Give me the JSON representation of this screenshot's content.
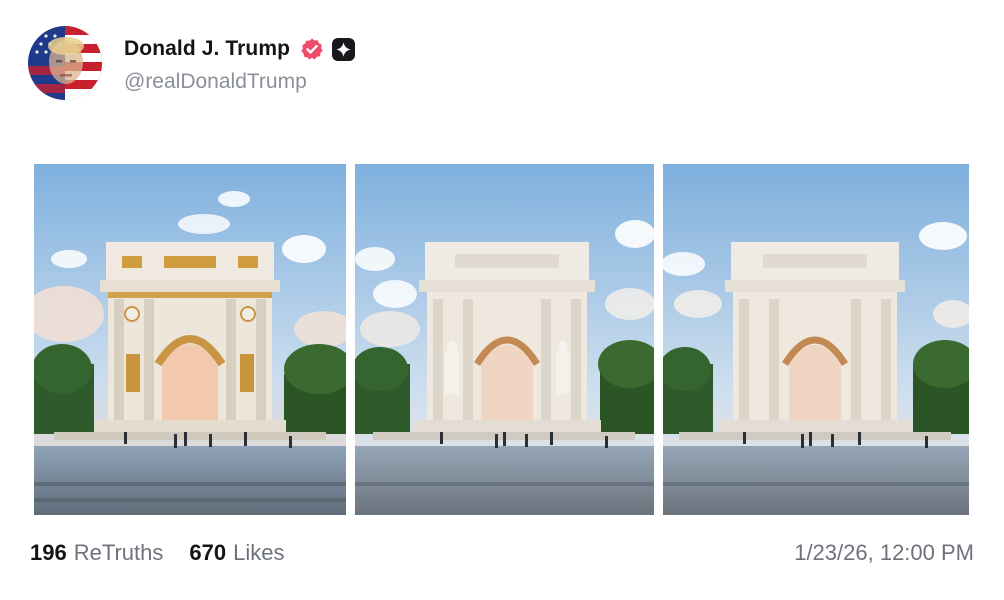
{
  "post": {
    "author": {
      "display_name": "Donald J. Trump",
      "handle": "@realDonaldTrump",
      "verified_badge": "verified-icon",
      "plus_badge": "plus-icon",
      "verified_color": "#ef4b6b"
    },
    "images": [
      {
        "description_icon": "arch-gilded-image",
        "variant": "gold"
      },
      {
        "description_icon": "arch-statues-image",
        "variant": "statues"
      },
      {
        "description_icon": "arch-plain-image",
        "variant": "plain"
      }
    ],
    "stats": {
      "retruths_count": "196",
      "retruths_label": "ReTruths",
      "likes_count": "670",
      "likes_label": "Likes"
    },
    "timestamp": "1/23/26, 12:00 PM"
  }
}
